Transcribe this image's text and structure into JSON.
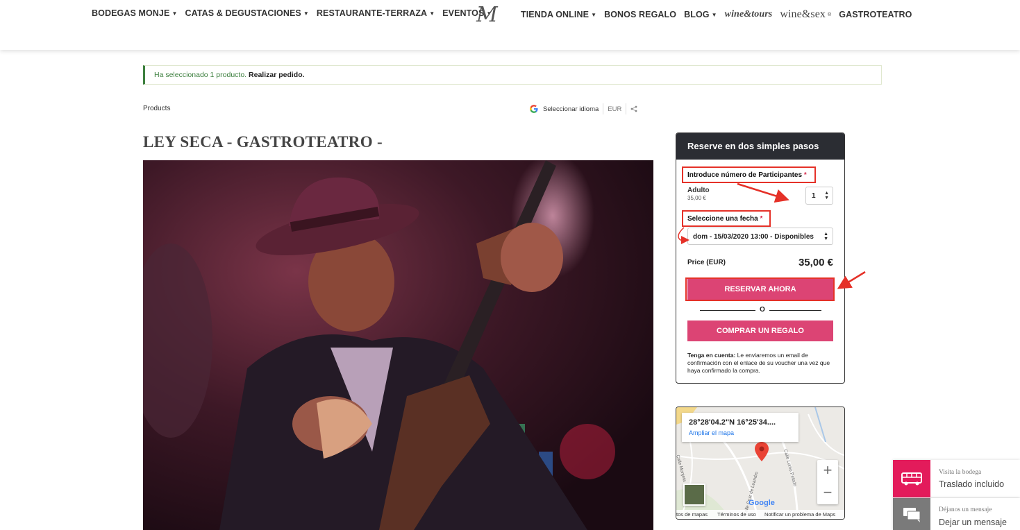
{
  "header": {
    "nav_left": [
      {
        "label": "BODEGAS MONJE",
        "dropdown": true
      },
      {
        "label": "CATAS & DEGUSTACIONES",
        "dropdown": true
      },
      {
        "label": "RESTAURANTE-TERRAZA",
        "dropdown": true
      },
      {
        "label": "EVENTOS",
        "dropdown": true
      }
    ],
    "logo": "M",
    "nav_right": [
      {
        "label": "TIENDA ONLINE",
        "dropdown": true
      },
      {
        "label": "BONOS REGALO",
        "dropdown": false
      },
      {
        "label": "BLOG",
        "dropdown": true
      }
    ],
    "logo_wine_tours": "wine&tours",
    "logo_wine_sex": "wine&sex",
    "logo_wine_sex_suffix": "®",
    "last_item": "GASTROTEATRO"
  },
  "notice": {
    "text": "Ha seleccionado 1 producto. ",
    "link": "Realizar pedido."
  },
  "breadcrumb": "Products",
  "tools": {
    "language": "Seleccionar idioma",
    "currency": "EUR"
  },
  "page_title": "LEY SECA - GASTROTEATRO -",
  "booking": {
    "heading": "Reserve en dos simples pasos",
    "participants_label": "Introduce número de Participantes",
    "required_mark": "*",
    "ticket_name": "Adulto",
    "ticket_price": "35,00 €",
    "quantity": "1",
    "date_label": "Seleccione una fecha",
    "date_value": "dom - 15/03/2020 13:00 - Disponibles",
    "price_label": "Price (EUR)",
    "price_value": "35,00 €",
    "reserve_button": "RESERVAR AHORA",
    "or_text": "O",
    "gift_button": "COMPRAR UN REGALO",
    "note_bold": "Tenga en cuenta:",
    "note_text": " Le enviaremos un email de confirmación con el enlace de su voucher una vez que haya confirmado la compra."
  },
  "map": {
    "coords": "28°28'04.2\"N 16°25'34....",
    "enlarge_link": "Ampliar el mapa",
    "zoom_in": "+",
    "zoom_out": "−",
    "google": "Google",
    "footer": [
      "tos de mapas",
      "Términos de uso",
      "Notificar un problema de Maps"
    ],
    "street_labels": [
      "Calle Monjeta",
      "Calle Cruz de Leandro",
      "Calle Lomo Pelado"
    ]
  },
  "widgets": {
    "visit_small": "Visita la bodega",
    "visit_big": "Traslado incluido",
    "message_small": "Déjanos un mensaje",
    "message_big": "Dejar un mensaje"
  },
  "colors": {
    "accent_pink": "#dc4474",
    "annotation_red": "#e53128",
    "header_dark": "#2b2d33",
    "notice_green": "#3c7f3e"
  }
}
